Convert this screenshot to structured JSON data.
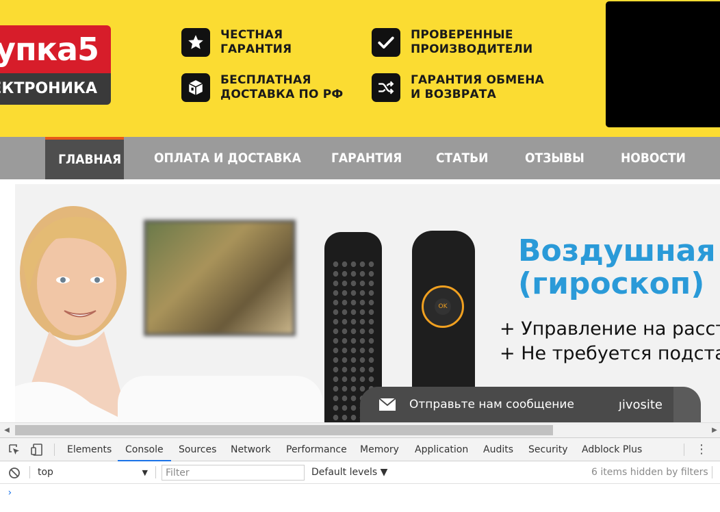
{
  "header": {
    "logo_top": "упка5",
    "logo_bottom": "ЕКТРОНИКА",
    "features": [
      {
        "icon": "star-icon",
        "text": "ЧЕСТНАЯ\nГАРАНТИЯ"
      },
      {
        "icon": "checkmark-icon",
        "text": "ПРОВЕРЕННЫЕ\nПРОИЗВОДИТЕЛИ"
      },
      {
        "icon": "box-icon",
        "text": "БЕСПЛАТНАЯ\nДОСТАВКА ПО РФ"
      },
      {
        "icon": "shuffle-icon",
        "text": "ГАРАНТИЯ ОБМЕНА\nИ ВОЗВРАТА"
      }
    ]
  },
  "nav": {
    "items": [
      "ГЛАВНАЯ",
      "ОПЛАТА И ДОСТАВКА",
      "ГАРАНТИЯ",
      "СТАТЬИ",
      "ОТЗЫВЫ",
      "НОВОСТИ"
    ],
    "active_index": 0
  },
  "banner": {
    "title": "Воздушная м\n(гироскоп)",
    "line1": "+ Управление на расстоя",
    "line2": "+ Не требуется подставк",
    "remote_ok": "OK"
  },
  "chat": {
    "message": "Отправьте нам сообщение",
    "brand": "ȷivosite"
  },
  "devtools": {
    "tabs": [
      "Elements",
      "Console",
      "Sources",
      "Network",
      "Performance",
      "Memory",
      "Application",
      "Audits",
      "Security",
      "Adblock Plus"
    ],
    "active_tab": "Console",
    "context": "top",
    "filter_placeholder": "Filter",
    "levels": "Default levels ▼",
    "hidden_info": "6 items hidden by filters",
    "prompt": "›"
  },
  "colors": {
    "header_bg": "#fbdc32",
    "nav_bg": "#9b9b9b",
    "nav_active": "#4e4e4e",
    "accent": "#e65a19",
    "banner_title": "#2a9ad8"
  }
}
